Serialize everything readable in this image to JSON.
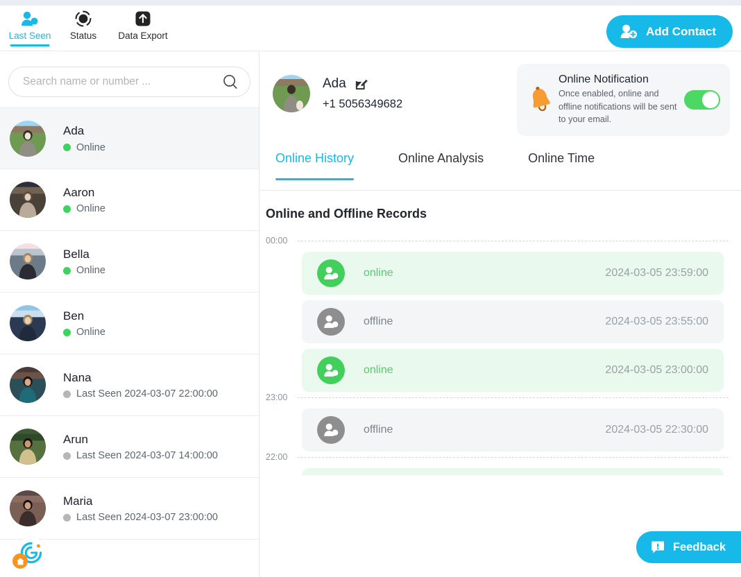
{
  "header": {
    "nav": [
      {
        "label": "Last Seen",
        "icon": "people-icon",
        "active": true
      },
      {
        "label": "Status",
        "icon": "record-dot-icon",
        "active": false
      },
      {
        "label": "Data Export",
        "icon": "upload-arrow-icon",
        "active": false
      }
    ],
    "add_contact_label": "Add Contact",
    "add_contact_icon": "add-person-icon"
  },
  "sidebar": {
    "search": {
      "placeholder": "Search name or number ...",
      "value": "",
      "icon": "search-icon"
    },
    "contacts": [
      {
        "name": "Ada",
        "status": "Online",
        "state": "online",
        "selected": true
      },
      {
        "name": "Aaron",
        "status": "Online",
        "state": "online",
        "selected": false
      },
      {
        "name": "Bella",
        "status": "Online",
        "state": "online",
        "selected": false
      },
      {
        "name": "Ben",
        "status": "Online",
        "state": "online",
        "selected": false
      },
      {
        "name": "Nana",
        "status": "Last Seen 2024-03-07 22:00:00",
        "state": "offline",
        "selected": false
      },
      {
        "name": "Arun",
        "status": "Last Seen 2024-03-07 14:00:00",
        "state": "offline",
        "selected": false
      },
      {
        "name": "Maria",
        "status": "Last Seen 2024-03-07 23:00:00",
        "state": "offline",
        "selected": false
      }
    ],
    "brand_badge": {
      "letter": "G",
      "overlay_icon": "home-icon"
    }
  },
  "profile": {
    "name": "Ada",
    "phone": "+1 5056349682",
    "edit_icon": "edit-square-icon",
    "avatar_icon": "avatar"
  },
  "notification": {
    "title": "Online Notification",
    "description": "Once enabled, online and offline notifications will be sent to your email.",
    "icon": "bell-icon",
    "toggle_on": true,
    "toggle_color": "#4bd863"
  },
  "tabs": [
    {
      "label": "Online History",
      "active": true
    },
    {
      "label": "Online Analysis",
      "active": false
    },
    {
      "label": "Online Time",
      "active": false
    }
  ],
  "records": {
    "title": "Online and Offline Records",
    "timeline": [
      {
        "kind": "marker",
        "time": "00:00"
      },
      {
        "kind": "record",
        "state": "online",
        "label": "online",
        "timestamp": "2024-03-05 23:59:00"
      },
      {
        "kind": "record",
        "state": "offline",
        "label": "offline",
        "timestamp": "2024-03-05 23:55:00"
      },
      {
        "kind": "record",
        "state": "online",
        "label": "online",
        "timestamp": "2024-03-05 23:00:00"
      },
      {
        "kind": "marker",
        "time": "23:00"
      },
      {
        "kind": "record",
        "state": "offline",
        "label": "offline",
        "timestamp": "2024-03-05 22:30:00"
      },
      {
        "kind": "marker",
        "time": "22:00"
      },
      {
        "kind": "partial",
        "state": "online"
      }
    ]
  },
  "feedback": {
    "label": "Feedback",
    "icon": "feedback-icon"
  },
  "colors": {
    "accent": "#17b9e8",
    "online": "#42cf5c",
    "offline": "#8e8e8e",
    "online_bg": "#e9f9ed",
    "offline_bg": "#f4f5f6"
  }
}
